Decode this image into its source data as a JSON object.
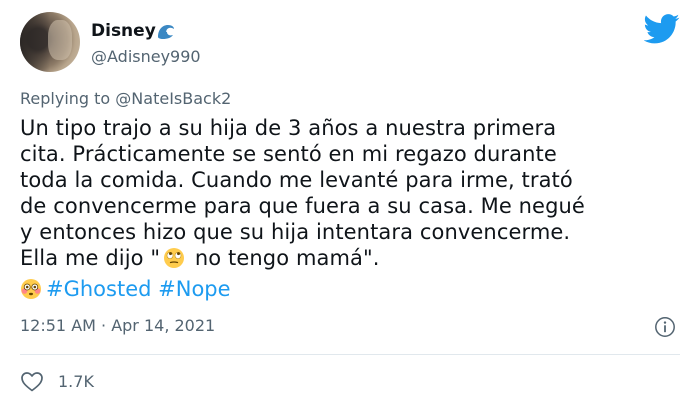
{
  "author": {
    "display_name": "Disney",
    "handle": "@Adisney990",
    "name_emoji_icon": "water-wave-icon"
  },
  "brand": {
    "icon": "twitter-bird-icon",
    "color": "#1d9bf0"
  },
  "reply": {
    "prefix": "Replying to ",
    "mention": "@NateIsBack2"
  },
  "tweet": {
    "line1": "Un tipo trajo a su hija de 3 años a nuestra primera",
    "line2": "cita. Prácticamente se sentó en mi regazo durante",
    "line3": "toda la comida. Cuando me levanté para irme, trató",
    "line4": "de convencerme para que fuera a su casa. Me negué",
    "line5": "y entonces hizo que su hija intentara convencerme.",
    "line6_before": "Ella me dijo \"",
    "line6_emoji": "face-with-rolling-eyes-icon",
    "line6_after": " no tengo mamá\".",
    "tags_emoji": "flushed-face-icon",
    "hashtags": [
      "#Ghosted",
      "#Nope"
    ]
  },
  "meta": {
    "timestamp": "12:51 AM · Apr 14, 2021",
    "info_icon": "info-icon"
  },
  "actions": {
    "like_icon": "heart-icon",
    "like_count": "1.7K"
  },
  "colors": {
    "text": "#0f1419",
    "secondary": "#536471",
    "link": "#1d9bf0",
    "divider": "#e1e8ed"
  }
}
